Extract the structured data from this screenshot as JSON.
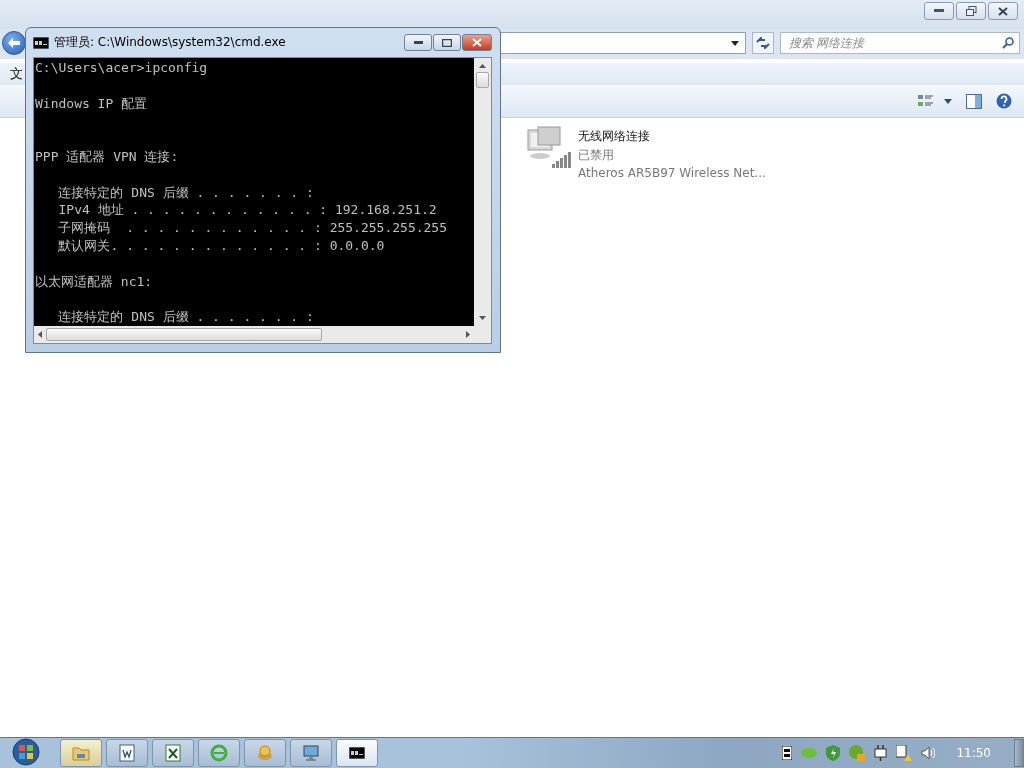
{
  "explorer": {
    "search": {
      "placeholder": "搜索 网络连接"
    },
    "menu": [
      "文"
    ],
    "items": [
      {
        "name": "无线网络连接",
        "status": "已禁用",
        "device": "Atheros AR5B97 Wireless Net..."
      }
    ]
  },
  "cmd": {
    "title": "管理员: C:\\Windows\\system32\\cmd.exe",
    "lines": [
      {
        "kind": "text",
        "text": "C:\\Users\\acer>ipconfig"
      },
      {
        "kind": "blank"
      },
      {
        "kind": "text",
        "text": "Windows IP 配置"
      },
      {
        "kind": "blank"
      },
      {
        "kind": "blank"
      },
      {
        "kind": "text",
        "text": "PPP 适配器 VPN 连接:"
      },
      {
        "kind": "blank"
      },
      {
        "kind": "text",
        "text": "   连接特定的 DNS 后缀 . . . . . . . :"
      },
      {
        "kind": "text",
        "text": "   IPv4 地址 . . . . . . . . . . . . : 192.168.251.2"
      },
      {
        "kind": "text",
        "text": "   子网掩码  . . . . . . . . . . . . : 255.255.255.255"
      },
      {
        "kind": "text",
        "text": "   默认网关. . . . . . . . . . . . . : 0.0.0.0"
      },
      {
        "kind": "blank"
      },
      {
        "kind": "text",
        "text": "以太网适配器 nc1:"
      },
      {
        "kind": "blank"
      },
      {
        "kind": "text",
        "text": "   连接特定的 DNS 后缀 . . . . . . . :"
      }
    ]
  },
  "taskbar": {
    "buttons": [
      {
        "kind": "folder",
        "selected": false,
        "highlighted": true
      },
      {
        "kind": "word",
        "selected": false,
        "highlighted": false
      },
      {
        "kind": "excel",
        "selected": false,
        "highlighted": false
      },
      {
        "kind": "browser",
        "selected": false,
        "highlighted": false
      },
      {
        "kind": "app",
        "selected": false,
        "highlighted": false
      },
      {
        "kind": "monitor",
        "selected": false,
        "highlighted": false
      },
      {
        "kind": "console",
        "selected": true,
        "highlighted": false
      }
    ],
    "clock": "11:50"
  }
}
